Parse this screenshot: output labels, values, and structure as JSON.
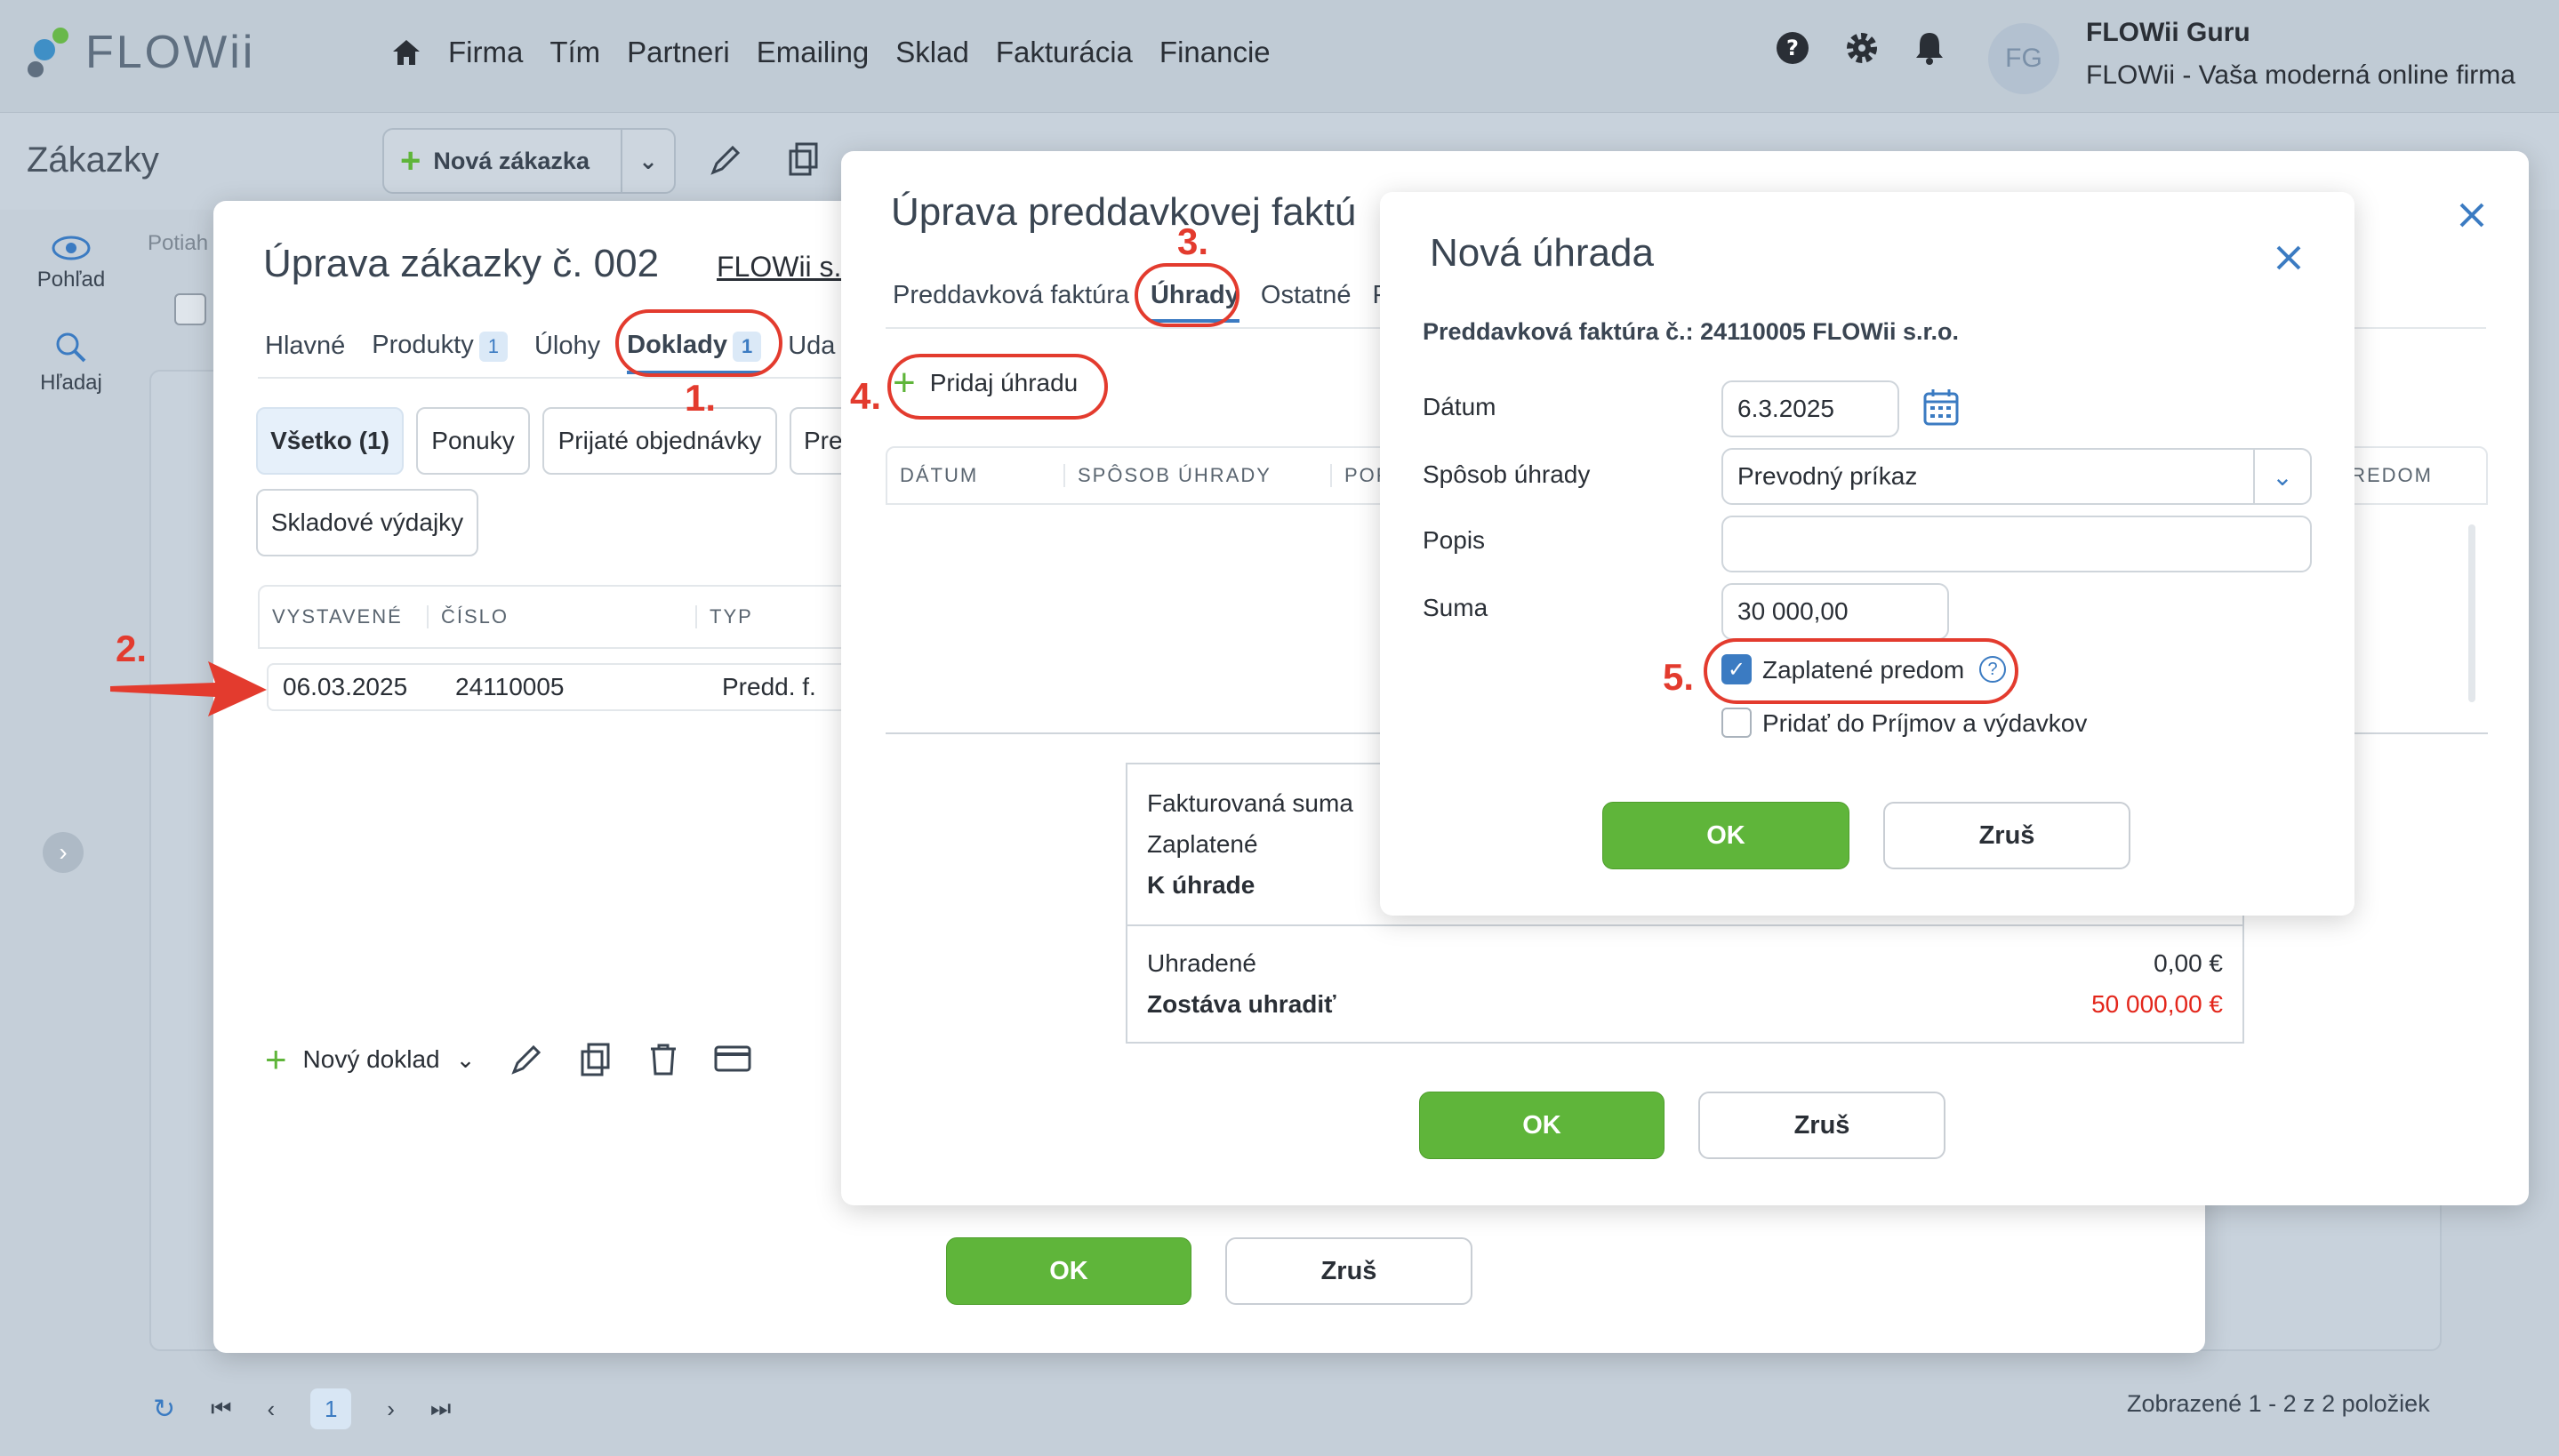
{
  "app": {
    "logo": "FLOWii",
    "nav": [
      "Firma",
      "Tím",
      "Partneri",
      "Emailing",
      "Sklad",
      "Fakturácia",
      "Financie"
    ],
    "user": {
      "initials": "FG",
      "name": "FLOWii Guru",
      "company": "FLOWii - Vaša moderná online firma"
    }
  },
  "page": {
    "title": "Zákazky",
    "new_button": "Nová zákazka",
    "side": [
      "Pohľad",
      "Hľadaj"
    ],
    "filter_hint": "Potiah",
    "pager": {
      "page": "1",
      "summary": "Zobrazené 1 - 2 z 2 položiek"
    }
  },
  "order_dialog": {
    "title": "Úprava zákazky č. 002",
    "partner": "FLOWii s.",
    "tabs": [
      {
        "label": "Hlavné"
      },
      {
        "label": "Produkty",
        "badge": "1"
      },
      {
        "label": "Úlohy"
      },
      {
        "label": "Doklady",
        "badge": "1"
      },
      {
        "label": "Uda"
      }
    ],
    "chips": [
      "Všetko (1)",
      "Ponuky",
      "Prijaté objednávky",
      "Pre",
      "Skladové výdajky"
    ],
    "columns": [
      "VYSTAVENÉ",
      "ČÍSLO",
      "TYP"
    ],
    "row": {
      "date": "06.03.2025",
      "number": "24110005",
      "type": "Predd. f."
    },
    "new_doc": "Nový doklad",
    "ok": "OK",
    "cancel": "Zruš"
  },
  "invoice_dialog": {
    "title": "Úprava preddavkovej faktú",
    "tabs": [
      "Preddavková faktúra",
      "Úhrady",
      "Ostatné",
      "P"
    ],
    "add_payment": "Pridaj úhradu",
    "columns": [
      "DÁTUM",
      "SPÔSOB ÚHRADY",
      "POP",
      "REDOM"
    ],
    "summary": {
      "invoiced_label": "Fakturovaná suma",
      "paid_label": "Zaplatené",
      "due_label": "K úhrade",
      "settled_label": "Uhradené",
      "settled_value": "0,00 €",
      "remaining_label": "Zostáva uhradiť",
      "remaining_value": "50 000,00 €"
    },
    "ok": "OK",
    "cancel": "Zruš"
  },
  "payment_dialog": {
    "title": "Nová úhrada",
    "subtitle": "Preddavková faktúra č.: 24110005 FLOWii s.r.o.",
    "date_label": "Dátum",
    "date_value": "6.3.2025",
    "method_label": "Spôsob úhrady",
    "method_value": "Prevodný príkaz",
    "desc_label": "Popis",
    "desc_value": "",
    "sum_label": "Suma",
    "sum_value": "30 000,00",
    "prepaid_label": "Zaplatené predom",
    "prepaid_checked": true,
    "income_label": "Pridať do Príjmov a výdavkov",
    "income_checked": false,
    "ok": "OK",
    "cancel": "Zruš"
  },
  "annotations": [
    "1.",
    "2.",
    "3.",
    "4.",
    "5."
  ],
  "colors": {
    "ok_green": "#5fb53a",
    "accent_blue": "#3b7bc2",
    "annotation_red": "#e33b2e"
  }
}
